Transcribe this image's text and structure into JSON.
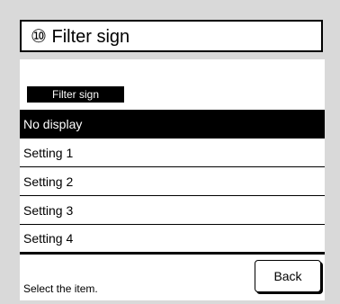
{
  "header": {
    "title": "⑩ Filter sign"
  },
  "section": {
    "label": "Filter sign"
  },
  "options": [
    {
      "label": "No display",
      "selected": true
    },
    {
      "label": "Setting 1",
      "selected": false
    },
    {
      "label": "Setting 2",
      "selected": false
    },
    {
      "label": "Setting 3",
      "selected": false
    },
    {
      "label": "Setting 4",
      "selected": false
    }
  ],
  "footer": {
    "hint": "Select the item.",
    "back_label": "Back"
  },
  "colors": {
    "background": "#d9d9d9",
    "screen": "#ffffff",
    "highlight": "#000000"
  }
}
